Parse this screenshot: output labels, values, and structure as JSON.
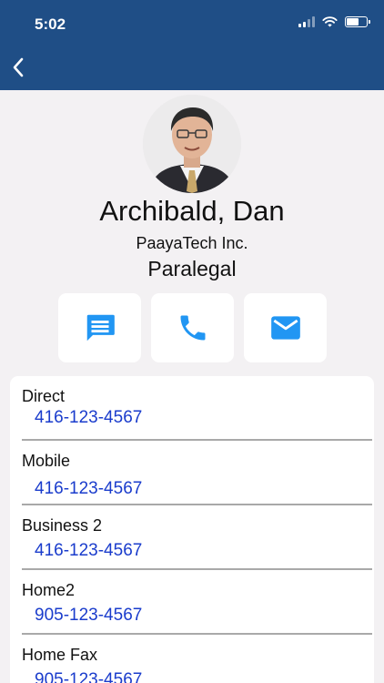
{
  "status_bar": {
    "time": "5:02"
  },
  "header": {
    "back_icon": "chevron-left-icon"
  },
  "contact": {
    "name": "Archibald, Dan",
    "company": "PaayaTech Inc.",
    "title": "Paralegal"
  },
  "actions": [
    {
      "icon": "message-icon"
    },
    {
      "icon": "phone-icon"
    },
    {
      "icon": "mail-icon"
    }
  ],
  "phones": [
    {
      "label": "Direct",
      "number": "416-123-4567"
    },
    {
      "label": "Mobile",
      "number": "416-123-4567"
    },
    {
      "label": "Business 2",
      "number": "416-123-4567"
    },
    {
      "label": "Home2",
      "number": "905-123-4567"
    },
    {
      "label": "Home Fax",
      "number": "905-123-4567"
    }
  ],
  "colors": {
    "header": "#1f4e86",
    "accent": "#2196f3",
    "link": "#1a3ccc",
    "background": "#f3f1f3"
  }
}
